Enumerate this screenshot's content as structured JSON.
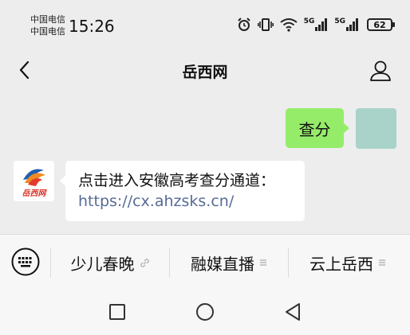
{
  "status": {
    "carrier_1": "中国电信",
    "carrier_2": "中国电信",
    "time": "15:26",
    "net_1": "5G",
    "net_2": "5G",
    "battery": "62",
    "icons": [
      "alarm-icon",
      "vibrate-icon",
      "wifi-icon",
      "signal-icon",
      "signal-icon",
      "battery-icon"
    ]
  },
  "header": {
    "title": "岳西网",
    "icons": [
      "back-icon",
      "user-icon"
    ]
  },
  "chat": {
    "outgoing": {
      "text": "查分"
    },
    "incoming": {
      "text": "点击进入安徽高考查分通道：",
      "link": "https://cx.ahzsks.cn/",
      "avatar_text": "岳西网"
    }
  },
  "menu": {
    "items": [
      "少儿春晚",
      "融媒直播",
      "云上岳西"
    ],
    "icons": [
      "keyboard-icon",
      "link-icon",
      "menu-icon"
    ]
  },
  "system_nav": {
    "icons": [
      "recents-icon",
      "home-icon",
      "back-triangle-icon"
    ]
  },
  "colors": {
    "bubble_green": "#95ec69",
    "link_blue": "#576b95",
    "background": "#ededed"
  }
}
